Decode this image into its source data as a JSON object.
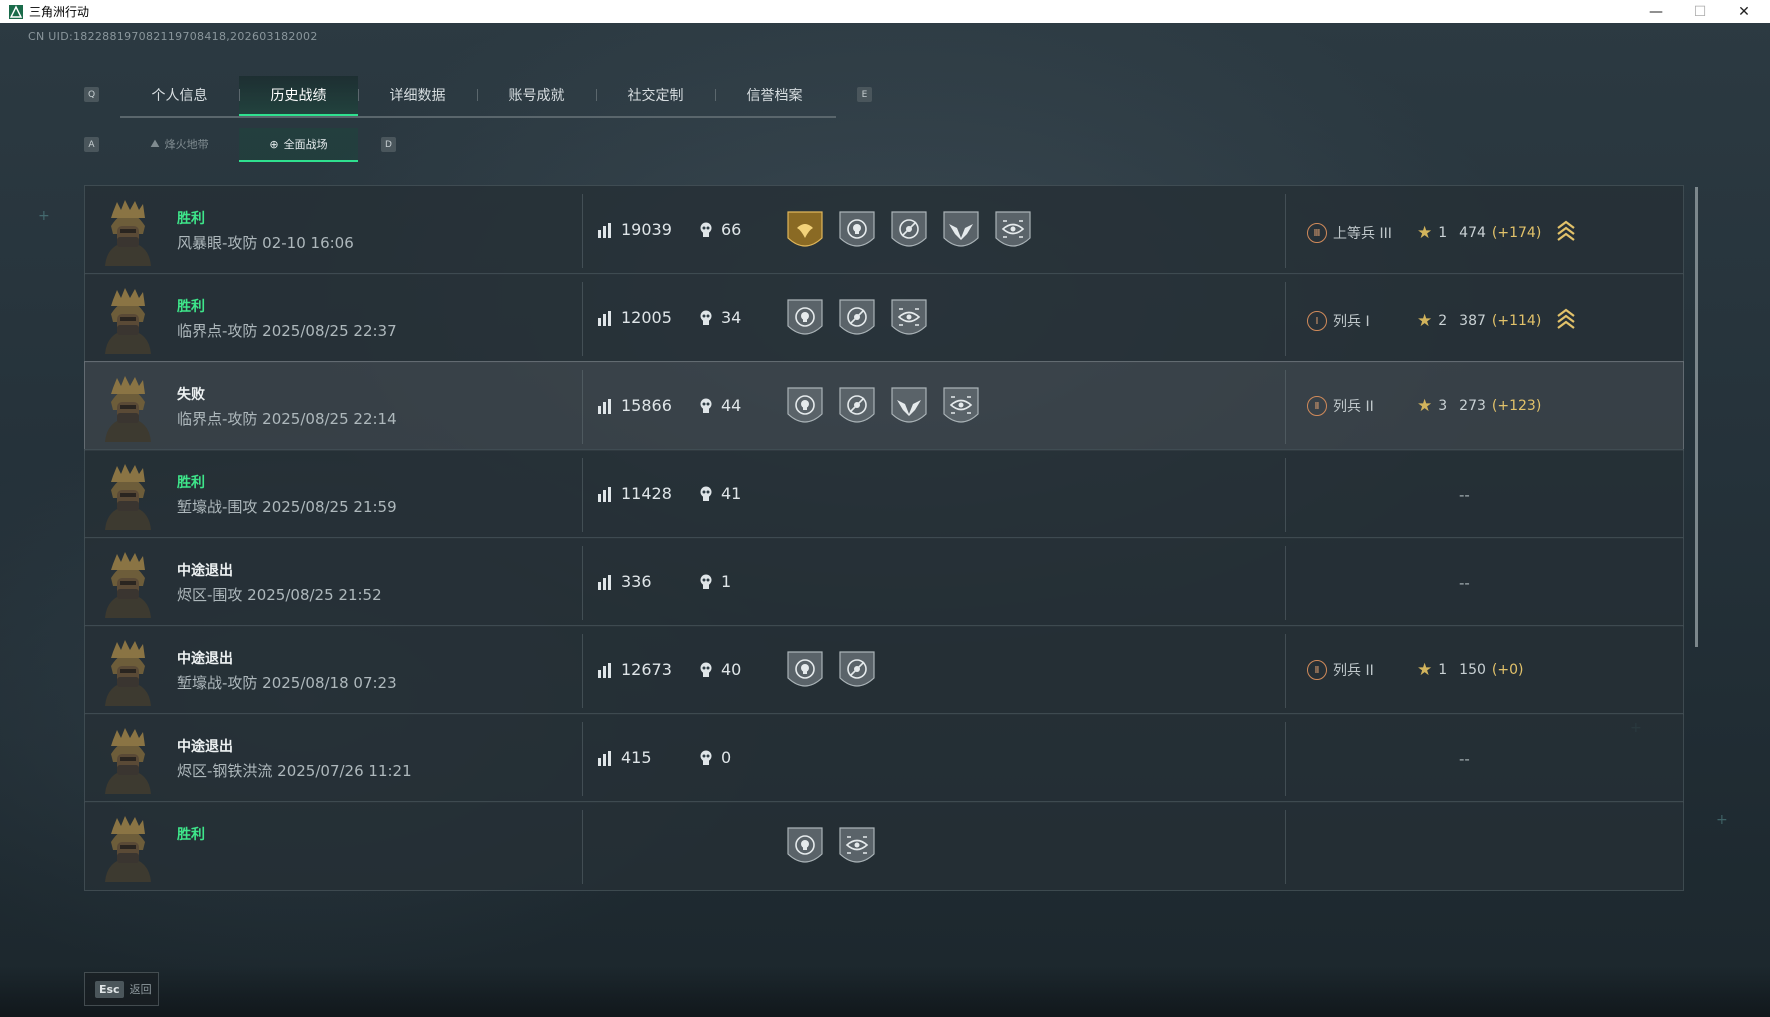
{
  "window": {
    "title": "三角洲行动",
    "minimize_glyph": "—",
    "maximize_glyph": "☐",
    "close_glyph": "✕"
  },
  "uid": "CN UID:18228819708211970841​8,202603182002",
  "keys": {
    "prev_tab": "Q",
    "next_tab": "E",
    "prev_sub": "A",
    "next_sub": "D"
  },
  "tabs": [
    "个人信息",
    "历史战绩",
    "详细数据",
    "账号成就",
    "社交定制",
    "信誉档案"
  ],
  "active_tab": "历史战绩",
  "subtabs": [
    {
      "label": "烽火地带",
      "icon": "mountain-icon"
    },
    {
      "label": "全面战场",
      "icon": "crosshair-icon"
    }
  ],
  "active_subtab": "全面战场",
  "matches": [
    {
      "result": "胜利",
      "win": true,
      "map": "风暴眼-攻防 02-10 16:06",
      "score": "19039",
      "kills": "66",
      "medals": [
        "gold-eagle",
        "skull",
        "no-entry",
        "winged-skull",
        "eye"
      ],
      "rank": "上等兵 III",
      "rank_icon": "Ⅲ",
      "stars": "1",
      "points": "474",
      "gain": "(+174)",
      "chevron": true
    },
    {
      "result": "胜利",
      "win": true,
      "map": "临界点-攻防 2025/08/25 22:37",
      "score": "12005",
      "kills": "34",
      "medals": [
        "skull",
        "no-entry",
        "eye"
      ],
      "rank": "列兵 I",
      "rank_icon": "Ⅰ",
      "stars": "2",
      "points": "387",
      "gain": "(+114)",
      "chevron": true
    },
    {
      "result": "失败",
      "win": false,
      "map": "临界点-攻防 2025/08/25 22:14",
      "score": "15866",
      "kills": "44",
      "medals": [
        "skull",
        "no-entry",
        "winged-skull",
        "eye"
      ],
      "rank": "列兵 II",
      "rank_icon": "Ⅱ",
      "stars": "3",
      "points": "273",
      "gain": "(+123)",
      "chevron": false
    },
    {
      "result": "胜利",
      "win": true,
      "map": "堑壕战-围攻 2025/08/25 21:59",
      "score": "11428",
      "kills": "41",
      "medals": [],
      "rank": null,
      "dash": "--"
    },
    {
      "result": "中途退出",
      "win": false,
      "map": "烬区-围攻 2025/08/25 21:52",
      "score": "336",
      "kills": "1",
      "medals": [],
      "rank": null,
      "dash": "--"
    },
    {
      "result": "中途退出",
      "win": false,
      "map": "堑壕战-攻防 2025/08/18 07:23",
      "score": "12673",
      "kills": "40",
      "medals": [
        "skull",
        "no-entry"
      ],
      "rank": "列兵 II",
      "rank_icon": "Ⅱ",
      "stars": "1",
      "points": "150",
      "gain": "(+0)",
      "chevron": false
    },
    {
      "result": "中途退出",
      "win": false,
      "map": "烬区-钢铁洪流 2025/07/26 11:21",
      "score": "415",
      "kills": "0",
      "medals": [],
      "rank": null,
      "dash": "--"
    },
    {
      "result": "胜利",
      "win": true,
      "map": "",
      "score": "",
      "kills": "",
      "medals": [
        "skull",
        "eye"
      ],
      "rank": "",
      "rank_icon": "",
      "stars": "",
      "points": "",
      "gain": "",
      "chevron": true
    }
  ],
  "footer": {
    "esc_key": "Esc",
    "esc_label": "返回"
  },
  "colors": {
    "win": "#3ee58a",
    "accent": "#2fe08f",
    "gold": "#d2b45c"
  }
}
